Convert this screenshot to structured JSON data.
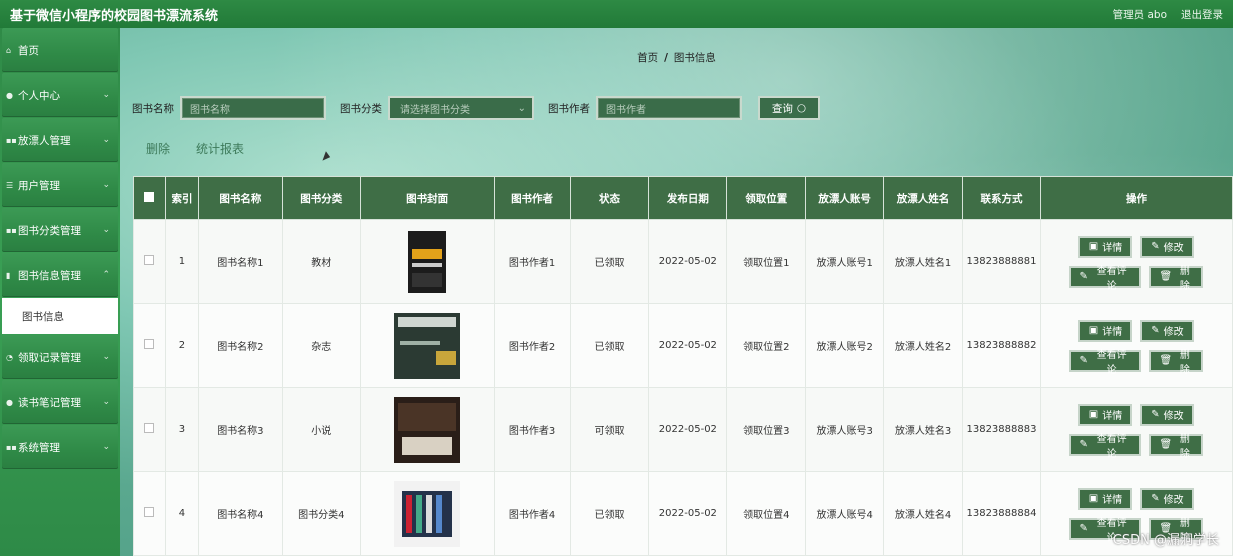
{
  "app": {
    "title": "基于微信小程序的校园图书漂流系统",
    "user_label": "管理员",
    "user_name": "abo",
    "logout": "退出登录"
  },
  "sidebar": {
    "items": [
      {
        "label": "首页",
        "icon": "home-icon"
      },
      {
        "label": "个人中心",
        "icon": "user-icon"
      },
      {
        "label": "放漂人管理",
        "icon": "grid-icon"
      },
      {
        "label": "用户管理",
        "icon": "list-icon"
      },
      {
        "label": "图书分类管理",
        "icon": "grid-icon"
      },
      {
        "label": "图书信息管理",
        "icon": "book-icon"
      },
      {
        "label": "领取记录管理",
        "icon": "clock-icon"
      },
      {
        "label": "读书笔记管理",
        "icon": "pin-icon"
      },
      {
        "label": "系统管理",
        "icon": "grid-icon"
      }
    ],
    "active_sub": "图书信息"
  },
  "breadcrumb": {
    "home": "首页",
    "sep": "/",
    "current": "图书信息"
  },
  "search": {
    "name_label": "图书名称",
    "name_placeholder": "图书名称",
    "category_label": "图书分类",
    "category_placeholder": "请选择图书分类",
    "author_label": "图书作者",
    "author_placeholder": "图书作者",
    "query_btn": "查询"
  },
  "actions": {
    "delete": "删除",
    "report": "统计报表"
  },
  "table": {
    "headers": [
      "索引",
      "图书名称",
      "图书分类",
      "图书封面",
      "图书作者",
      "状态",
      "发布日期",
      "领取位置",
      "放漂人账号",
      "放漂人姓名",
      "联系方式",
      "操作"
    ],
    "rows": [
      {
        "index": "1",
        "name": "图书名称1",
        "category": "教材",
        "cover": "cover-1",
        "author": "图书作者1",
        "status": "已领取",
        "date": "2022-05-02",
        "location": "领取位置1",
        "account": "放漂人账号1",
        "person": "放漂人姓名1",
        "phone": "13823888881"
      },
      {
        "index": "2",
        "name": "图书名称2",
        "category": "杂志",
        "cover": "cover-2",
        "author": "图书作者2",
        "status": "已领取",
        "date": "2022-05-02",
        "location": "领取位置2",
        "account": "放漂人账号2",
        "person": "放漂人姓名2",
        "phone": "13823888882"
      },
      {
        "index": "3",
        "name": "图书名称3",
        "category": "小说",
        "cover": "cover-3",
        "author": "图书作者3",
        "status": "可领取",
        "date": "2022-05-02",
        "location": "领取位置3",
        "account": "放漂人账号3",
        "person": "放漂人姓名3",
        "phone": "13823888883"
      },
      {
        "index": "4",
        "name": "图书名称4",
        "category": "图书分类4",
        "cover": "cover-4",
        "author": "图书作者4",
        "status": "已领取",
        "date": "2022-05-02",
        "location": "领取位置4",
        "account": "放漂人账号4",
        "person": "放漂人姓名4",
        "phone": "13823888884"
      }
    ],
    "ops": {
      "detail": "详情",
      "edit": "修改",
      "comments": "查看评论",
      "delete": "删除"
    }
  },
  "watermark": "CSDN @漏洞学长"
}
